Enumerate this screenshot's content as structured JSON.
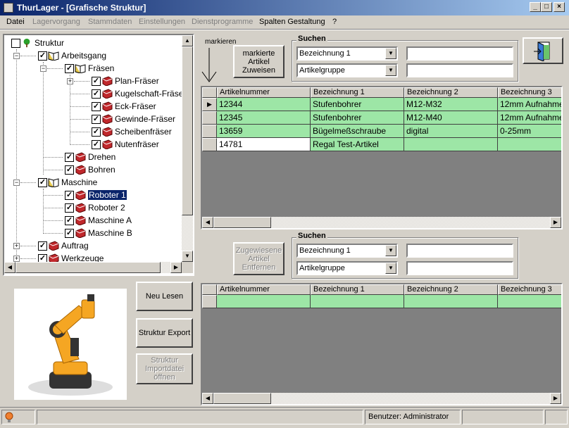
{
  "window": {
    "title": "ThurLager - [Grafische Struktur]",
    "buttons": {
      "min": "_",
      "max": "□",
      "close": "×"
    }
  },
  "menu": {
    "items": [
      {
        "label": "Datei",
        "enabled": true
      },
      {
        "label": "Lagervorgang",
        "enabled": false
      },
      {
        "label": "Stammdaten",
        "enabled": false
      },
      {
        "label": "Einstellungen",
        "enabled": false
      },
      {
        "label": "Dienstprogramme",
        "enabled": false
      },
      {
        "label": "Spalten Gestaltung",
        "enabled": true
      },
      {
        "label": "?",
        "enabled": true
      }
    ]
  },
  "tree": {
    "root": "Struktur",
    "nodes": [
      {
        "label": "Arbeitsgang"
      },
      {
        "label": "Fräsen"
      },
      {
        "label": "Plan-Fräser"
      },
      {
        "label": "Kugelschaft-Fräser"
      },
      {
        "label": "Eck-Fräser"
      },
      {
        "label": "Gewinde-Fräser"
      },
      {
        "label": "Scheibenfräser"
      },
      {
        "label": "Nutenfräser"
      },
      {
        "label": "Drehen"
      },
      {
        "label": "Bohren"
      },
      {
        "label": "Maschine"
      },
      {
        "label": "Roboter 1"
      },
      {
        "label": "Roboter 2"
      },
      {
        "label": "Maschine A"
      },
      {
        "label": "Maschine B"
      },
      {
        "label": "Auftrag"
      },
      {
        "label": "Werkzeuge"
      }
    ]
  },
  "actions": {
    "markieren_label": "markieren",
    "assign_button": "markierte Artikel Zuweisen",
    "remove_button": "Zugewiesene Artikel Entfernen",
    "reload_button": "Neu Lesen",
    "export_button": "Struktur Export",
    "import_button": "Struktur Importdatei öffnen"
  },
  "search_top": {
    "title": "Suchen",
    "field1": "Bezeichnung 1",
    "field2": "Artikelgruppe",
    "value1": "",
    "value2": ""
  },
  "search_bottom": {
    "title": "Suchen",
    "field1": "Bezeichnung 1",
    "field2": "Artikelgruppe",
    "value1": "",
    "value2": ""
  },
  "grid_top": {
    "columns": [
      "Artikelnummer",
      "Bezeichnung 1",
      "Bezeichnung 2",
      "Bezeichnung 3"
    ],
    "rows": [
      [
        "12344",
        "Stufenbohrer",
        "M12-M32",
        "12mm Aufnahme"
      ],
      [
        "12345",
        "Stufenbohrer",
        "M12-M40",
        "12mm Aufnahme"
      ],
      [
        "13659",
        "Bügelmeßschraube",
        "digital",
        "0-25mm"
      ],
      [
        "14781",
        "Regal Test-Artikel",
        "",
        ""
      ]
    ]
  },
  "grid_bottom": {
    "columns": [
      "Artikelnummer",
      "Bezeichnung 1",
      "Bezeichnung 2",
      "Bezeichnung 3"
    ],
    "rows": [
      [
        "",
        "",
        "",
        ""
      ]
    ]
  },
  "status": {
    "user": "Benutzer: Administrator"
  },
  "colors": {
    "row_green": "#9de6a6",
    "titlebar": "#0a246a",
    "robot_orange": "#f5a623"
  }
}
